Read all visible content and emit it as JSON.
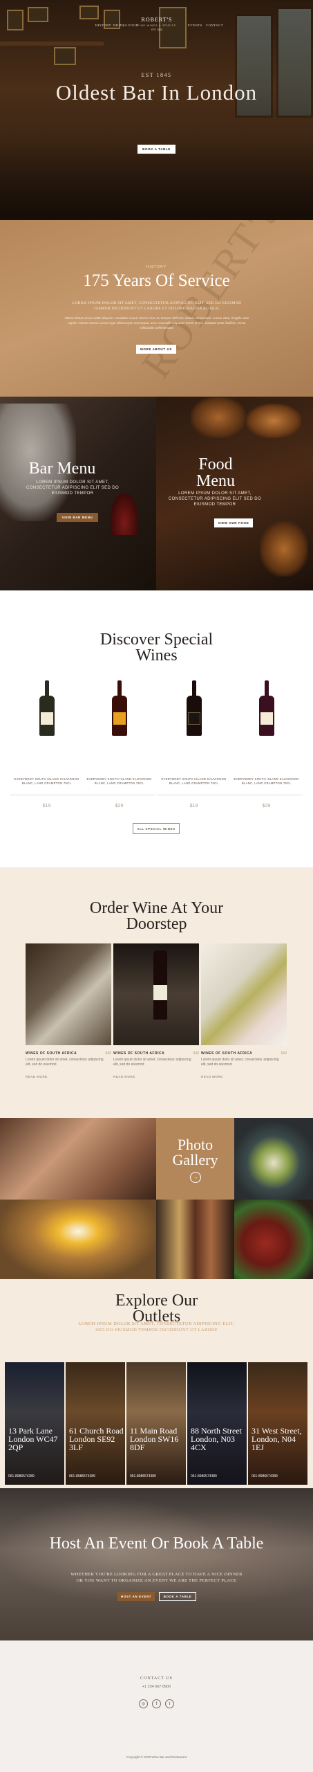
{
  "nav": {
    "items": [
      "HISTORY",
      "DRINKS",
      "FOOD",
      "EVENTS",
      "CONTACT"
    ],
    "logo_title": "ROBERT'S",
    "logo_sub": "FINE WINES & SPIRITS",
    "logo_year": "EST 1845"
  },
  "hero": {
    "est": "EST 1845",
    "title": "Oldest Bar In London",
    "button": "BOOK A TABLE"
  },
  "service": {
    "sub": "HISTORY",
    "title": "175 Years Of Service",
    "lead": "LOREM IPSUM DOLOR SIT AMET, CONSECTETUR ADIPISCING ELIT, SED DO EIUSMOD TEMPOR INCIDIDUNT UT LABORE ET DOLORE MAGNA ALIQUA.",
    "body": "Platea dictum et eu mattis aliquam. Curabitur mauris fames risus et, tempor nibh nec, lacinia elementum. Luctus vitae, fringilla vitae sapien. Donec massa cursus eget ullamcorper consequat, arcu. Convallis vulputate lorem id nisl. Volutpat tortor facilisis, est ac sollicitudin pellentesque.",
    "button": "MORE ABOUT US",
    "watermark": "ROBERT'S"
  },
  "bar": {
    "title": "Bar Menu",
    "text": "LOREM IPSUM DOLOR SIT AMET, CONSECTETUR ADIPISCING ELIT SED DO EIUSMOD TEMPOR",
    "button": "VIEW BAR MENU"
  },
  "food": {
    "title": "Food Menu",
    "text": "LOREM IPSUM DOLOR SIT AMET, CONSECTETUR ADIPISCING ELIT SED DO EIUSMOD TEMPOR",
    "button": "VIEW OUR FOOD"
  },
  "wines": {
    "title": "Discover Special Wines",
    "items": [
      {
        "text": "EVERYBODY SOUTH ISLAND SAUVIGNON BLANC, LAND CRAMPTON 75CL",
        "price": "$19"
      },
      {
        "text": "EVERYBODY SOUTH ISLAND SAUVIGNON BLANC, LAND CRAMPTON 75CL",
        "price": "$29"
      },
      {
        "text": "EVERYBODY SOUTH ISLAND SAUVIGNON BLANC, LAND CRAMPTON 75CL",
        "price": "$19"
      },
      {
        "text": "EVERYBODY SOUTH ISLAND SAUVIGNON BLANC, LAND CRAMPTON 75CL",
        "price": "$29"
      }
    ],
    "button": "ALL SPECIAL WINES"
  },
  "order": {
    "title": "Order Wine At Your Doorstep",
    "items": [
      {
        "title": "WINES OF SOUTH AFRICA",
        "price": "$40",
        "desc": "Lorem ipsum dolor sit amet, consectetur adipiscing elit, sed do eiusmod",
        "more": "READ MORE"
      },
      {
        "title": "WINES OF SOUTH AFRICA",
        "price": "$40",
        "desc": "Lorem ipsum dolor sit amet, consectetur adipiscing elit, sed do eiusmod",
        "more": "READ MORE"
      },
      {
        "title": "WINES OF SOUTH AFRICA",
        "price": "$40",
        "desc": "Lorem ipsum dolor sit amet, consectetur adipiscing elit, sed do eiusmod",
        "more": "READ MORE"
      }
    ]
  },
  "gallery": {
    "title": "Photo Gallery",
    "arrow": "→"
  },
  "outlets": {
    "title": "Explore Our Outlets",
    "text": "LOREM IPSUM DOLOR SIT AMET, CONSECTETUR ADIPISCING ELIT, SED DO EIUSMOD TEMPOR INCIDIDUNT UT LABORE",
    "items": [
      {
        "address": "13 Park Lane London WC47 2QP",
        "tel": "061-8986574389"
      },
      {
        "address": "61 Church Road London SE92 3LF",
        "tel": "061-8986574389"
      },
      {
        "address": "11 Main Road London SW16 8DF",
        "tel": "061-8986574389"
      },
      {
        "address": "88 North Street London, N03 4CX",
        "tel": "061-8986574389"
      },
      {
        "address": "31 West Street, London, N04 1EJ",
        "tel": "061-8986574389"
      }
    ]
  },
  "event": {
    "title": "Host An Event Or Book A Table",
    "text": "WHETHER YOU'RE LOOKING FOR A GREAT PLACE TO HAVE A NICE DINNER OR YOU WANT TO ORGANIZE AN EVENT WE ARE THE PERFECT PLACE",
    "button_event": "HOST AN EVENT",
    "button_table": "BOOK A TABLE"
  },
  "footer": {
    "heading": "CONTACT US",
    "phone": "+1 234 667 8900",
    "social": [
      "◎",
      "f",
      "t"
    ],
    "copyright": "Copyright © 2020 Wine Bar and Restaurant"
  }
}
